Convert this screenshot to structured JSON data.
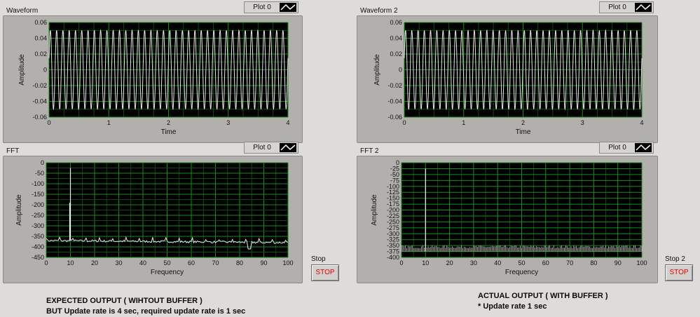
{
  "panels": [
    {
      "id": "waveform-1",
      "title": "Waveform",
      "legend": "Plot 0",
      "kind": "waveform",
      "chart_data": {
        "type": "line",
        "xlabel": "Time",
        "ylabel": "Amplitude",
        "xlim": [
          0,
          4
        ],
        "ylim": [
          -0.06,
          0.06
        ],
        "xticks": [
          "0",
          "1",
          "2",
          "3",
          "4"
        ],
        "yticks": [
          "0.06",
          "0.04",
          "0.02",
          "0",
          "-0.02",
          "-0.04",
          "-0.06"
        ],
        "series": [
          {
            "cycles": 38,
            "amplitude": 0.05
          }
        ]
      }
    },
    {
      "id": "waveform-2",
      "title": "Waveform 2",
      "legend": "Plot 0",
      "kind": "waveform",
      "chart_data": {
        "type": "line",
        "xlabel": "Time",
        "ylabel": "Amplitude",
        "xlim": [
          0,
          4
        ],
        "ylim": [
          -0.06,
          0.06
        ],
        "xticks": [
          "0",
          "1",
          "2",
          "3",
          "4"
        ],
        "yticks": [
          "0.06",
          "0.04",
          "0.02",
          "0",
          "-0.02",
          "-0.04",
          "-0.06"
        ],
        "series": [
          {
            "cycles": 38,
            "amplitude": 0.05
          }
        ]
      }
    },
    {
      "id": "fft-1",
      "title": "FFT",
      "legend": "Plot 0",
      "kind": "fft1",
      "chart_data": {
        "type": "line",
        "xlabel": "Frequency",
        "ylabel": "Amplitude",
        "xlim": [
          0,
          100
        ],
        "ylim": [
          -450,
          0
        ],
        "xticks": [
          "0",
          "10",
          "20",
          "30",
          "40",
          "50",
          "60",
          "70",
          "80",
          "90",
          "100"
        ],
        "yticks": [
          "0",
          "-50",
          "-100",
          "-150",
          "-200",
          "-250",
          "-300",
          "-350",
          "-400",
          "-450"
        ],
        "series": [
          {
            "peak_x": 10,
            "peak_y": -25,
            "floor": -370
          }
        ]
      }
    },
    {
      "id": "fft-2",
      "title": "FFT 2",
      "legend": "Plot 0",
      "kind": "fft2",
      "chart_data": {
        "type": "line",
        "xlabel": "Frequency",
        "ylabel": "Amplitude",
        "xlim": [
          0,
          100
        ],
        "ylim": [
          -400,
          0
        ],
        "xticks": [
          "0",
          "10",
          "20",
          "30",
          "40",
          "50",
          "60",
          "70",
          "80",
          "90",
          "100"
        ],
        "yticks": [
          "0",
          "-25",
          "-50",
          "-75",
          "-100",
          "-125",
          "-150",
          "-175",
          "-200",
          "-225",
          "-250",
          "-275",
          "-300",
          "-325",
          "-350",
          "-375",
          "-400"
        ],
        "series": [
          {
            "peak_x": 10,
            "peak_y": -25,
            "floor_top": -355,
            "floor_bottom": -375
          }
        ]
      }
    }
  ],
  "stop1": {
    "label": "Stop",
    "button": "STOP"
  },
  "stop2": {
    "label": "Stop 2",
    "button": "STOP"
  },
  "notes": {
    "left_line1": "EXPECTED OUTPUT ( WIHTOUT BUFFER )",
    "left_line2": "BUT Update rate is 4 sec, required update rate is 1 sec",
    "right_line1": "ACTUAL OUTPUT ( WITH BUFFER )",
    "right_line2": "* Update rate 1 sec"
  }
}
